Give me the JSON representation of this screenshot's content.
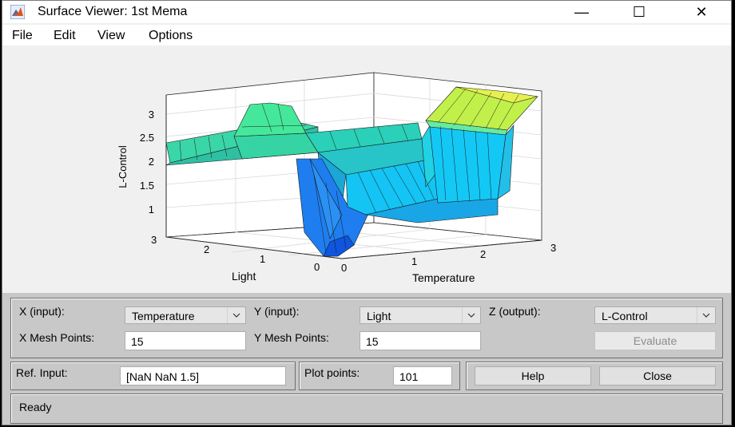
{
  "window": {
    "title": "Surface Viewer: 1st Mema",
    "minimize_glyph": "—",
    "maximize_glyph": "☐",
    "close_glyph": "✕"
  },
  "menu": [
    "File",
    "Edit",
    "View",
    "Options"
  ],
  "chart_data": {
    "type": "surface3d",
    "x_axis_label": "Temperature",
    "y_axis_label": "Light",
    "z_axis_label": "L-Control",
    "x_ticks": [
      "0",
      "1",
      "2",
      "3"
    ],
    "y_ticks": [
      "0",
      "1",
      "2",
      "3"
    ],
    "z_ticks": [
      "1",
      "1.5",
      "2",
      "2.5",
      "3"
    ],
    "x_range": [
      0,
      3
    ],
    "y_range": [
      0,
      3
    ],
    "z_range": [
      0.7,
      3.5
    ],
    "grid": true,
    "colormap": "parula"
  },
  "controls": {
    "x_input_label": "X (input):",
    "x_input_value": "Temperature",
    "y_input_label": "Y (input):",
    "y_input_value": "Light",
    "z_output_label": "Z (output):",
    "z_output_value": "L-Control",
    "x_mesh_label": "X Mesh Points:",
    "x_mesh_value": "15",
    "y_mesh_label": "Y Mesh Points:",
    "y_mesh_value": "15",
    "evaluate_label": "Evaluate",
    "ref_input_label": "Ref. Input:",
    "ref_input_value": "[NaN NaN 1.5]",
    "plot_points_label": "Plot points:",
    "plot_points_value": "101",
    "help_label": "Help",
    "close_label": "Close"
  },
  "status": {
    "text": "Ready"
  }
}
